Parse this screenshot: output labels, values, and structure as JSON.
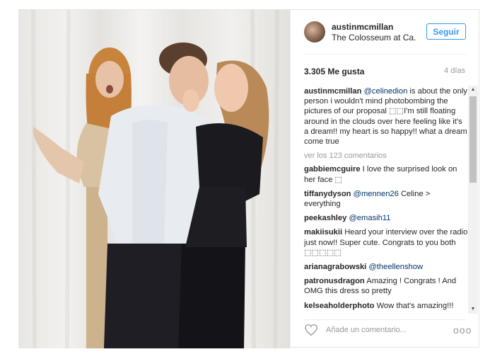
{
  "header": {
    "username": "austinmcmillan",
    "location": "The Colosseum at Ca..",
    "follow_label": "Seguir"
  },
  "stats": {
    "likes": "3.305 Me gusta",
    "time": "4 días"
  },
  "caption": {
    "user": "austinmcmillan",
    "mention": "@celinedion",
    "text": " is about the only person i wouldn't mind photobombing the pictures of our proposal ⬚⬚I'm still floating around in the clouds over here feeling like it's a dream!! my heart is so happy!! what a dream come true"
  },
  "view_all": "ver los 123 comentarios",
  "comments": [
    {
      "user": "gabbiemcguire",
      "mention": "",
      "text": " I love the surprised look on her face ⬚"
    },
    {
      "user": "tiffanydyson",
      "mention": " @mennen26",
      "text": " Celine > everything"
    },
    {
      "user": "peekashley",
      "mention": " @emasih11",
      "text": ""
    },
    {
      "user": "makiisukii",
      "mention": "",
      "text": " Heard your interview over the radio just now!! Super cute. Congrats to you both ⬚⬚⬚⬚⬚"
    },
    {
      "user": "arianagrabowski",
      "mention": " @theellenshow",
      "text": ""
    },
    {
      "user": "patronusdragon",
      "mention": "",
      "text": " Amazing ! Congrats ! And OMG this dress so pretty"
    },
    {
      "user": "kelseaholderphoto",
      "mention": "",
      "text": " Wow that's amazing!!!"
    }
  ],
  "footer": {
    "comment_placeholder": "Añade un comentario...",
    "more_label": "ooo"
  },
  "scrollbar": {
    "up_arrow": "▲",
    "down_arrow": "▼"
  },
  "colors": {
    "accent": "#3897f0",
    "mention": "#003569",
    "muted": "#999999"
  }
}
